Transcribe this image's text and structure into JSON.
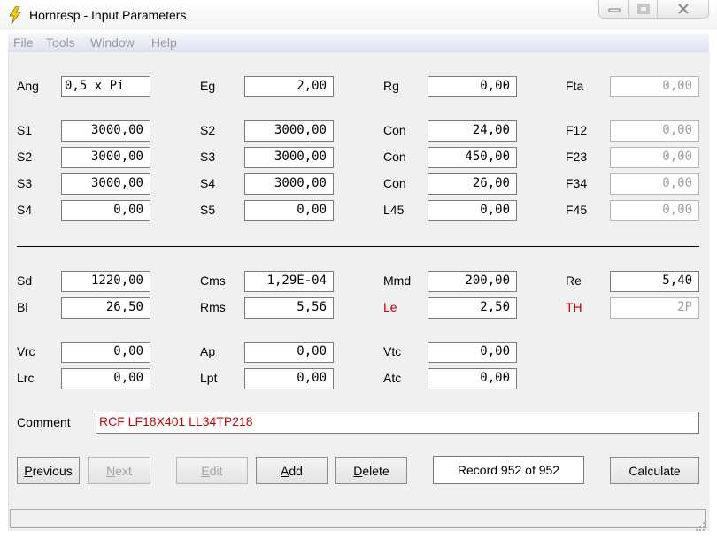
{
  "window": {
    "title": "Hornresp - Input Parameters",
    "minimize_icon": "minimize-icon",
    "maximize_icon": "maximize-icon",
    "close_icon": "close-icon"
  },
  "menu": {
    "file": "File",
    "tools": "Tools",
    "window": "Window",
    "help": "Help"
  },
  "labels": {
    "ang": "Ang",
    "eg": "Eg",
    "rg": "Rg",
    "fta": "Fta",
    "s1": "S1",
    "s2a": "S2",
    "con1": "Con",
    "f12": "F12",
    "s2": "S2",
    "s3a": "S3",
    "con2": "Con",
    "f23": "F23",
    "s3": "S3",
    "s4a": "S4",
    "con3": "Con",
    "f34": "F34",
    "s4": "S4",
    "s5": "S5",
    "l45": "L45",
    "f45": "F45",
    "sd": "Sd",
    "cms": "Cms",
    "mmd": "Mmd",
    "re": "Re",
    "bl": "Bl",
    "rms": "Rms",
    "le": "Le",
    "th": "TH",
    "vrc": "Vrc",
    "ap": "Ap",
    "vtc": "Vtc",
    "lrc": "Lrc",
    "lpt": "Lpt",
    "atc": "Atc",
    "comment": "Comment"
  },
  "values": {
    "ang": "0,5 x Pi",
    "eg": "2,00",
    "rg": "0,00",
    "fta": "0,00",
    "s1": "3000,00",
    "s2a": "3000,00",
    "con1": "24,00",
    "f12": "0,00",
    "s2": "3000,00",
    "s3a": "3000,00",
    "con2": "450,00",
    "f23": "0,00",
    "s3": "3000,00",
    "s4a": "3000,00",
    "con3": "26,00",
    "f34": "0,00",
    "s4": "0,00",
    "s5": "0,00",
    "l45": "0,00",
    "f45": "0,00",
    "sd": "1220,00",
    "cms": "1,29E-04",
    "mmd": "200,00",
    "re": "5,40",
    "bl": "26,50",
    "rms": "5,56",
    "le": "2,50",
    "th": "2P",
    "vrc": "0,00",
    "ap": "0,00",
    "vtc": "0,00",
    "lrc": "0,00",
    "lpt": "0,00",
    "atc": "0,00",
    "comment": "RCF LF18X401 LL34TP218"
  },
  "buttons": {
    "previous": "Previous",
    "next": "Next",
    "edit": "Edit",
    "add": "Add",
    "delete": "Delete",
    "calculate": "Calculate"
  },
  "record": "Record 952 of 952",
  "colors": {
    "accent_red": "#cc0000",
    "menu_gradient_bottom": "#dde2f0",
    "client_bg": "#f0f0f0"
  }
}
